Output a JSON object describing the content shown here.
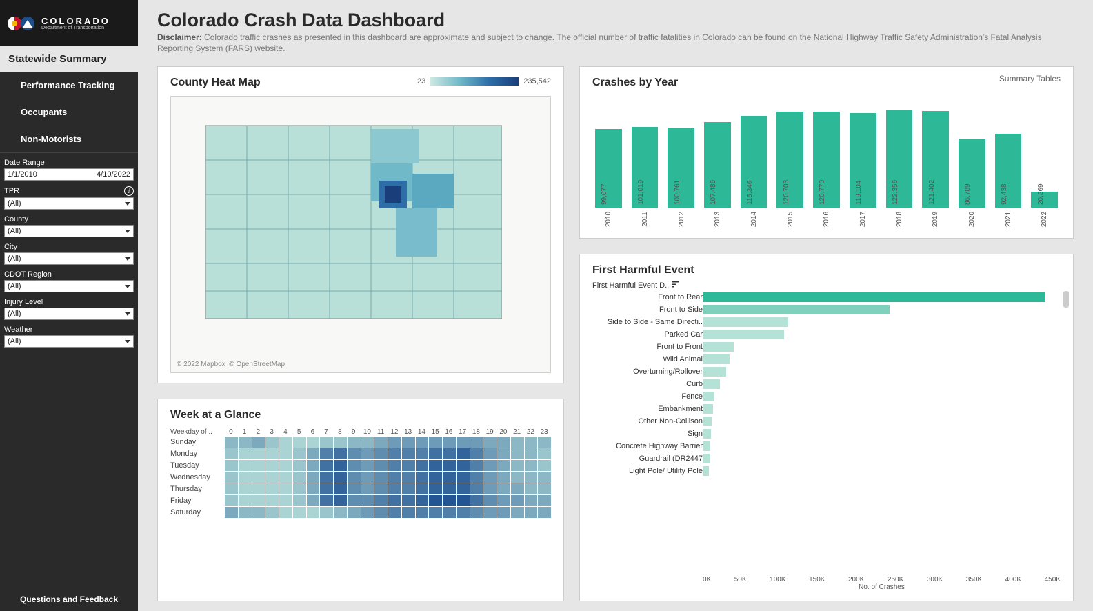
{
  "brand": {
    "name": "COLORADO",
    "dept": "Department of Transportation"
  },
  "sidebar": {
    "active": "Statewide Summary",
    "items": [
      "Performance Tracking",
      "Occupants",
      "Non-Motorists"
    ],
    "filters": {
      "date_label": "Date Range",
      "date_from": "1/1/2010",
      "date_to": "4/10/2022",
      "tpr_label": "TPR",
      "tpr_value": "(All)",
      "county_label": "County",
      "county_value": "(All)",
      "city_label": "City",
      "city_value": "(All)",
      "region_label": "CDOT Region",
      "region_value": "(All)",
      "injury_label": "Injury Level",
      "injury_value": "(All)",
      "weather_label": "Weather",
      "weather_value": "(All)"
    },
    "footer": "Questions and Feedback"
  },
  "header": {
    "title": "Colorado Crash Data Dashboard",
    "disclaimer_label": "Disclaimer:",
    "disclaimer_text": "Colorado traffic crashes as presented in this dashboard are approximate and subject to change. The official number of traffic fatalities in Colorado can be found on the National Highway Traffic Safety Administration's Fatal Analysis Reporting System (FARS) website."
  },
  "heatmap_card": {
    "title": "County Heat Map",
    "legend_min": "23",
    "legend_max": "235,542",
    "attrib1": "© 2022 Mapbox",
    "attrib2": "© OpenStreetMap"
  },
  "year_card": {
    "title": "Crashes by Year",
    "link": "Summary Tables"
  },
  "week_card": {
    "title": "Week at a Glance",
    "col_header": "Weekday of ..",
    "days": [
      "Sunday",
      "Monday",
      "Tuesday",
      "Wednesday",
      "Thursday",
      "Friday",
      "Saturday"
    ]
  },
  "harm_card": {
    "title": "First Harmful Event",
    "col_header": "First Harmful Event D..",
    "xlabel": "No. of Crashes",
    "ticks": [
      "0K",
      "50K",
      "100K",
      "150K",
      "200K",
      "250K",
      "300K",
      "350K",
      "400K",
      "450K"
    ]
  },
  "chart_data": [
    {
      "type": "bar",
      "title": "Crashes by Year",
      "categories": [
        "2010",
        "2011",
        "2012",
        "2013",
        "2014",
        "2015",
        "2016",
        "2017",
        "2018",
        "2019",
        "2020",
        "2021",
        "2022"
      ],
      "values": [
        99077,
        101019,
        100761,
        107486,
        115346,
        120703,
        120770,
        119104,
        122356,
        121402,
        86789,
        92438,
        20269
      ],
      "ylim": [
        0,
        130000
      ]
    },
    {
      "type": "bar",
      "title": "First Harmful Event",
      "orientation": "horizontal",
      "categories": [
        "Front to Rear",
        "Front to Side",
        "Side to Side - Same Directi..",
        "Parked Car",
        "Front to Front",
        "Wild Animal",
        "Overturning/Rollover",
        "Curb",
        "Fence",
        "Embankment",
        "Other Non-Collison",
        "Sign",
        "Concrete Highway Barrier",
        "Guardrail (DR2447",
        "Light Pole/ Utility Pole"
      ],
      "values": [
        440000,
        240000,
        110000,
        105000,
        40000,
        35000,
        30000,
        22000,
        15000,
        13000,
        12000,
        11000,
        10000,
        9000,
        8000
      ],
      "xlabel": "No. of Crashes",
      "xlim": [
        0,
        460000
      ]
    },
    {
      "type": "heatmap",
      "title": "Week at a Glance",
      "y": [
        "Sunday",
        "Monday",
        "Tuesday",
        "Wednesday",
        "Thursday",
        "Friday",
        "Saturday"
      ],
      "x": [
        0,
        1,
        2,
        3,
        4,
        5,
        6,
        7,
        8,
        9,
        10,
        11,
        12,
        13,
        14,
        15,
        16,
        17,
        18,
        19,
        20,
        21,
        22,
        23
      ],
      "intensity": [
        [
          3,
          3,
          4,
          2,
          1,
          1,
          1,
          2,
          2,
          3,
          3,
          4,
          5,
          5,
          5,
          5,
          5,
          5,
          5,
          4,
          4,
          3,
          3,
          3
        ],
        [
          2,
          1,
          1,
          1,
          1,
          2,
          4,
          7,
          8,
          6,
          5,
          6,
          7,
          7,
          7,
          8,
          8,
          9,
          7,
          5,
          4,
          3,
          3,
          2
        ],
        [
          2,
          1,
          1,
          1,
          1,
          2,
          4,
          8,
          9,
          6,
          5,
          6,
          7,
          7,
          8,
          9,
          9,
          9,
          7,
          5,
          4,
          3,
          3,
          2
        ],
        [
          2,
          1,
          1,
          1,
          1,
          2,
          4,
          8,
          9,
          6,
          5,
          6,
          7,
          7,
          8,
          9,
          9,
          9,
          7,
          5,
          4,
          3,
          3,
          3
        ],
        [
          2,
          1,
          1,
          1,
          1,
          2,
          4,
          8,
          9,
          6,
          5,
          6,
          7,
          7,
          8,
          9,
          9,
          9,
          7,
          5,
          4,
          4,
          3,
          3
        ],
        [
          2,
          1,
          1,
          1,
          1,
          2,
          4,
          8,
          9,
          6,
          6,
          7,
          8,
          8,
          9,
          10,
          10,
          10,
          8,
          6,
          5,
          5,
          4,
          4
        ],
        [
          4,
          3,
          3,
          2,
          1,
          1,
          1,
          2,
          3,
          4,
          5,
          6,
          7,
          7,
          7,
          7,
          7,
          7,
          6,
          5,
          5,
          4,
          4,
          4
        ]
      ],
      "note": "intensity 1-10 estimated from color darkness"
    },
    {
      "type": "heatmap",
      "title": "County Heat Map",
      "value_range": [
        23,
        235542
      ],
      "note": "choropleth of Colorado counties; Denver-metro counties darkest"
    }
  ]
}
